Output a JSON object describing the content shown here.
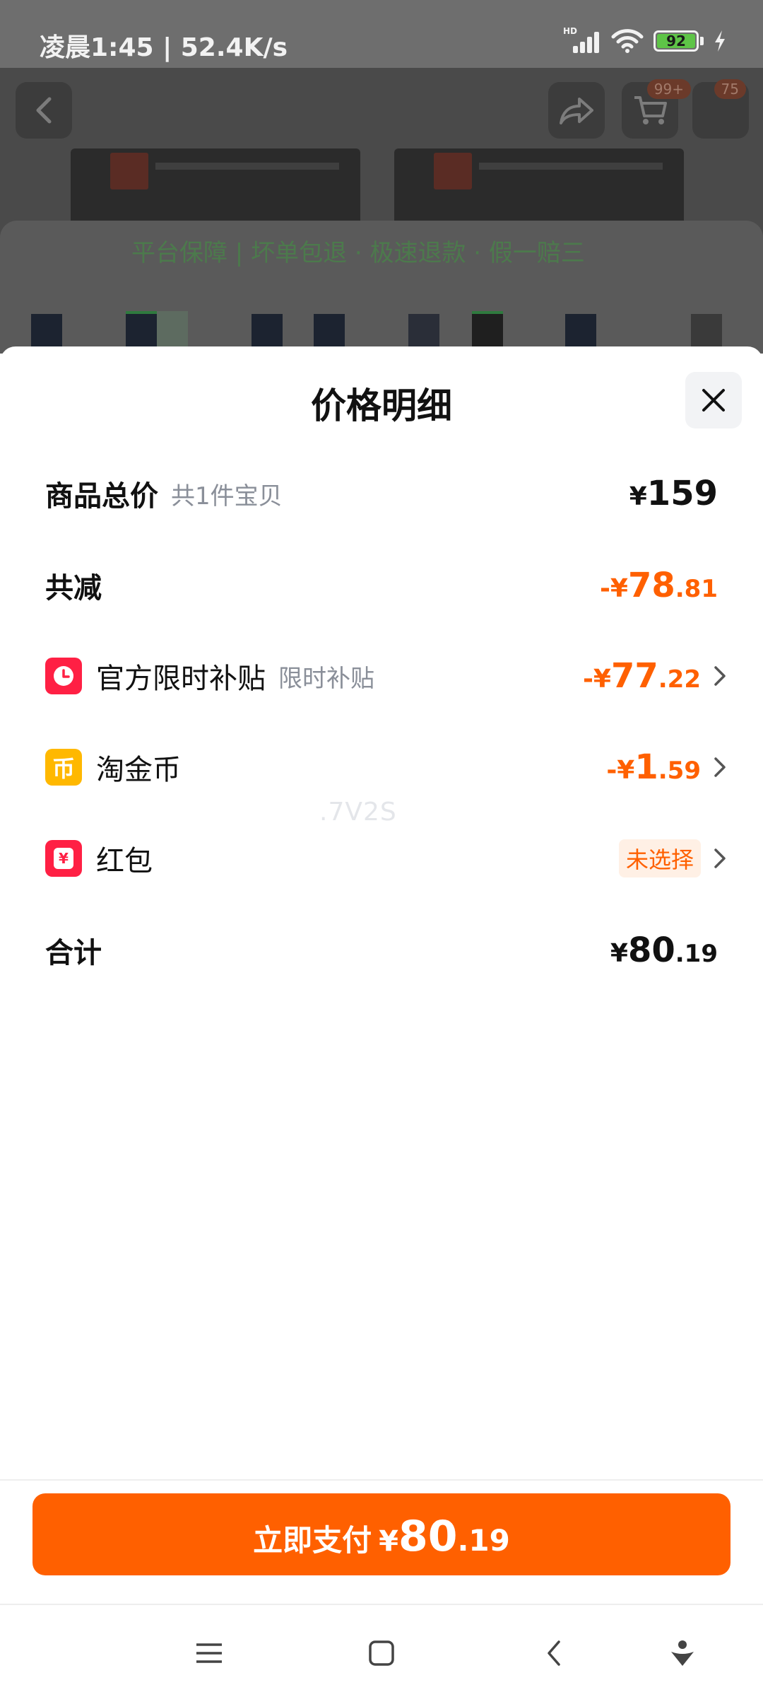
{
  "status_bar": {
    "time_speed": "凌晨1:45 | 52.4K/s",
    "signal_label": "HD",
    "battery": "92"
  },
  "background_page": {
    "cart_badge": "99+",
    "msg_badge": "75",
    "overlay_text": "平台保障 | 坏单包退 · 极速退款 · 假一赔三"
  },
  "sheet": {
    "title": "价格明细",
    "rows": {
      "total": {
        "label": "商品总价",
        "sub": "共1件宝贝",
        "sym": "¥",
        "int": "159",
        "dec": ""
      },
      "reduce": {
        "label": "共减",
        "sym": "-¥",
        "int": "78",
        "dec": ".81"
      },
      "subsidy": {
        "label": "官方限时补贴",
        "sub": "限时补贴",
        "sym": "-¥",
        "int": "77",
        "dec": ".22",
        "icon": "clock-icon"
      },
      "coin": {
        "label": "淘金币",
        "sym": "-¥",
        "int": "1",
        "dec": ".59",
        "icon": "coin-icon",
        "icon_text": "币"
      },
      "redpacket": {
        "label": "红包",
        "tag": "未选择",
        "icon": "red-packet-icon",
        "icon_text": "¥"
      },
      "sum": {
        "label": "合计",
        "sym": "¥",
        "int": "80",
        "dec": ".19"
      }
    },
    "watermark": ".7V2S"
  },
  "pay_button": {
    "label": "立即支付",
    "sym": "¥",
    "int": "80",
    "dec": ".19"
  },
  "colors": {
    "accent": "#ff6000",
    "danger_icon": "#ff2044",
    "coin_icon": "#ffb800"
  }
}
